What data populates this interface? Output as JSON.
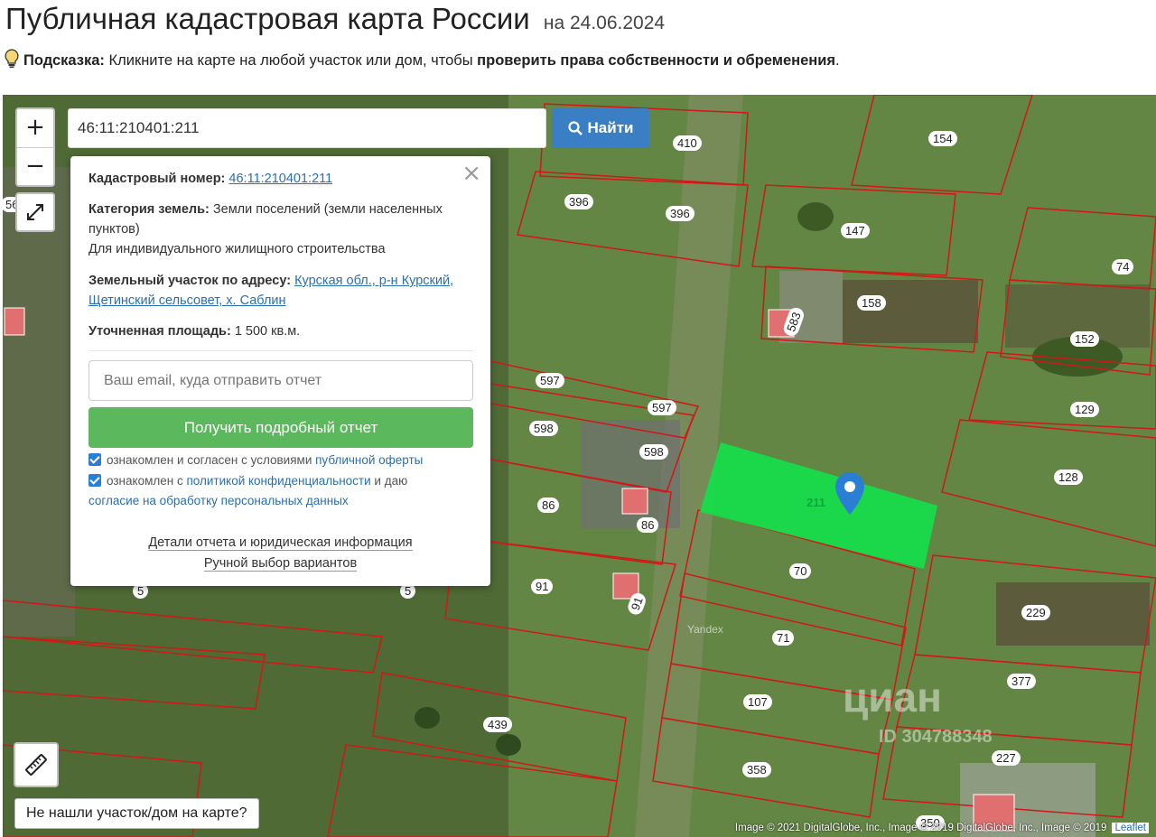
{
  "header": {
    "title": "Публичная кадастровая карта России",
    "date": "на 24.06.2024"
  },
  "hint": {
    "label": "Подсказка:",
    "text": "Кликните на карте на любой участок или дом, чтобы",
    "bold_text": "проверить права собственности и обременения",
    "end": "."
  },
  "map": {
    "zoom_in": "+",
    "zoom_out": "−",
    "not_found": "Не нашли участок/дом на карте?",
    "yandex": "Yandex",
    "attribution": "Image © 2021 DigitalGlobe, Inc., Image © 2019 DigitalGlobe, Inc., Image © 2019",
    "leaflet": "Leaflet",
    "watermark": "циан",
    "watermark_id": "ID 304788348",
    "selected_label": "211",
    "plot_labels": [
      "410",
      "154",
      "396",
      "396",
      "147",
      "74",
      "158",
      "583",
      "152",
      "597",
      "597",
      "129",
      "598",
      "598",
      "128",
      "86",
      "86",
      "70",
      "91",
      "91",
      "229",
      "71",
      "377",
      "107",
      "439",
      "227",
      "358",
      "350",
      "56",
      "5",
      "5"
    ]
  },
  "search": {
    "value": "46:11:210401:211",
    "button": "Найти"
  },
  "popup": {
    "close": "×",
    "cadastral_label": "Кадастровый номер:",
    "cadastral_value": "46:11:210401:211",
    "category_label": "Категория земель:",
    "category_value": "Земли поселений (земли населенных пунктов)",
    "use": "Для индивидуального жилищного строительства",
    "address_label": "Земельный участок по адресу:",
    "address_value": "Курская обл., р-н Курский, Щетинский сельсовет, х. Саблин",
    "area_label": "Уточненная площадь:",
    "area_value": "1 500 кв.м.",
    "email_placeholder": "Ваш email, куда отправить отчет",
    "report_button": "Получить подробный отчет",
    "check1_text": "ознакомлен и согласен с условиями",
    "check1_link": "публичной оферты",
    "check2_text": "ознакомлен с",
    "check2_link": "политикой конфиденциальности",
    "check2_text2": "и даю",
    "check2_link2": "согласие на обработку персональных данных",
    "details_link": "Детали отчета и юридическая информация",
    "manual_link": "Ручной выбор вариантов"
  }
}
